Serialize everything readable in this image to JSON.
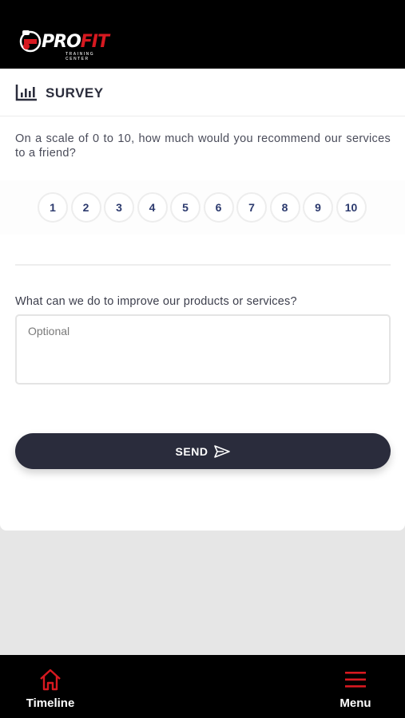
{
  "app": {
    "logo_main": "PRO",
    "logo_accent": "FIT",
    "logo_sub": "TRAINING CENTER"
  },
  "survey": {
    "title": "SURVEY",
    "icon": "bar-chart-icon",
    "question": "On a scale of 0 to 10, how much would you recommend our services to a friend?",
    "scale": [
      "1",
      "2",
      "3",
      "4",
      "5",
      "6",
      "7",
      "8",
      "9",
      "10"
    ],
    "improve_label": "What can we do to improve our products or services?",
    "improve_placeholder": "Optional",
    "improve_value": "",
    "send_label": "SEND"
  },
  "bottom_nav": {
    "timeline_label": "Timeline",
    "menu_label": "Menu",
    "accent_color": "#d71920"
  }
}
